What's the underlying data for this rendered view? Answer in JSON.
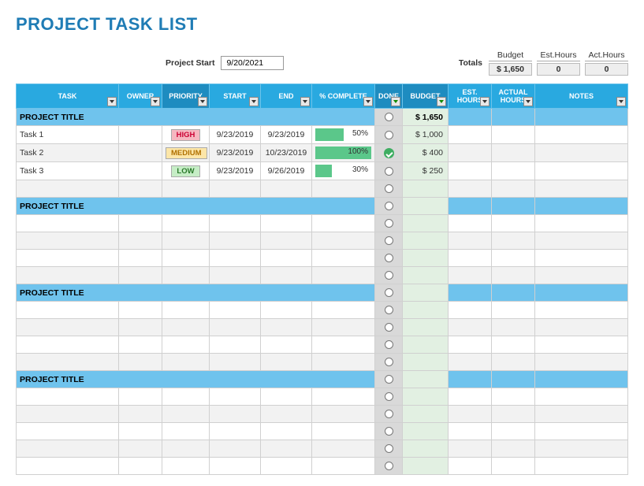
{
  "title": "PROJECT TASK LIST",
  "project_start": {
    "label": "Project Start",
    "value": "9/20/2021"
  },
  "totals": {
    "label": "Totals"
  },
  "summary": {
    "budget": {
      "label": "Budget",
      "value": "$  1,650"
    },
    "est_hours": {
      "label": "Est.Hours",
      "value": "0"
    },
    "act_hours": {
      "label": "Act.Hours",
      "value": "0"
    }
  },
  "columns": {
    "task": "TASK",
    "owner": "OWNER",
    "priority": "PRIORITY",
    "start": "START",
    "end": "END",
    "pct": "% COMPLETE",
    "done": "DONE",
    "budget": "BUDGET",
    "est": "EST. HOURS",
    "act": "ACTUAL HOURS",
    "notes": "NOTES"
  },
  "sections": [
    {
      "title": "PROJECT TITLE",
      "budget": "$   1,650",
      "rows": [
        {
          "task": "Task 1",
          "priority": "HIGH",
          "prio_class": "high",
          "start": "9/23/2019",
          "end": "9/23/2019",
          "pct": 50,
          "pct_text": "50%",
          "done": false,
          "budget": "$   1,000"
        },
        {
          "task": "Task 2",
          "priority": "MEDIUM",
          "prio_class": "medium",
          "start": "9/23/2019",
          "end": "10/23/2019",
          "pct": 100,
          "pct_text": "100%",
          "done": true,
          "budget": "$      400"
        },
        {
          "task": "Task 3",
          "priority": "LOW",
          "prio_class": "low",
          "start": "9/23/2019",
          "end": "9/26/2019",
          "pct": 30,
          "pct_text": "30%",
          "done": false,
          "budget": "$      250"
        }
      ],
      "blank_rows": 1
    },
    {
      "title": "PROJECT TITLE",
      "budget": "",
      "rows": [],
      "blank_rows": 4
    },
    {
      "title": "PROJECT TITLE",
      "budget": "",
      "rows": [],
      "blank_rows": 4
    },
    {
      "title": "PROJECT TITLE",
      "budget": "",
      "rows": [],
      "blank_rows": 5
    }
  ]
}
